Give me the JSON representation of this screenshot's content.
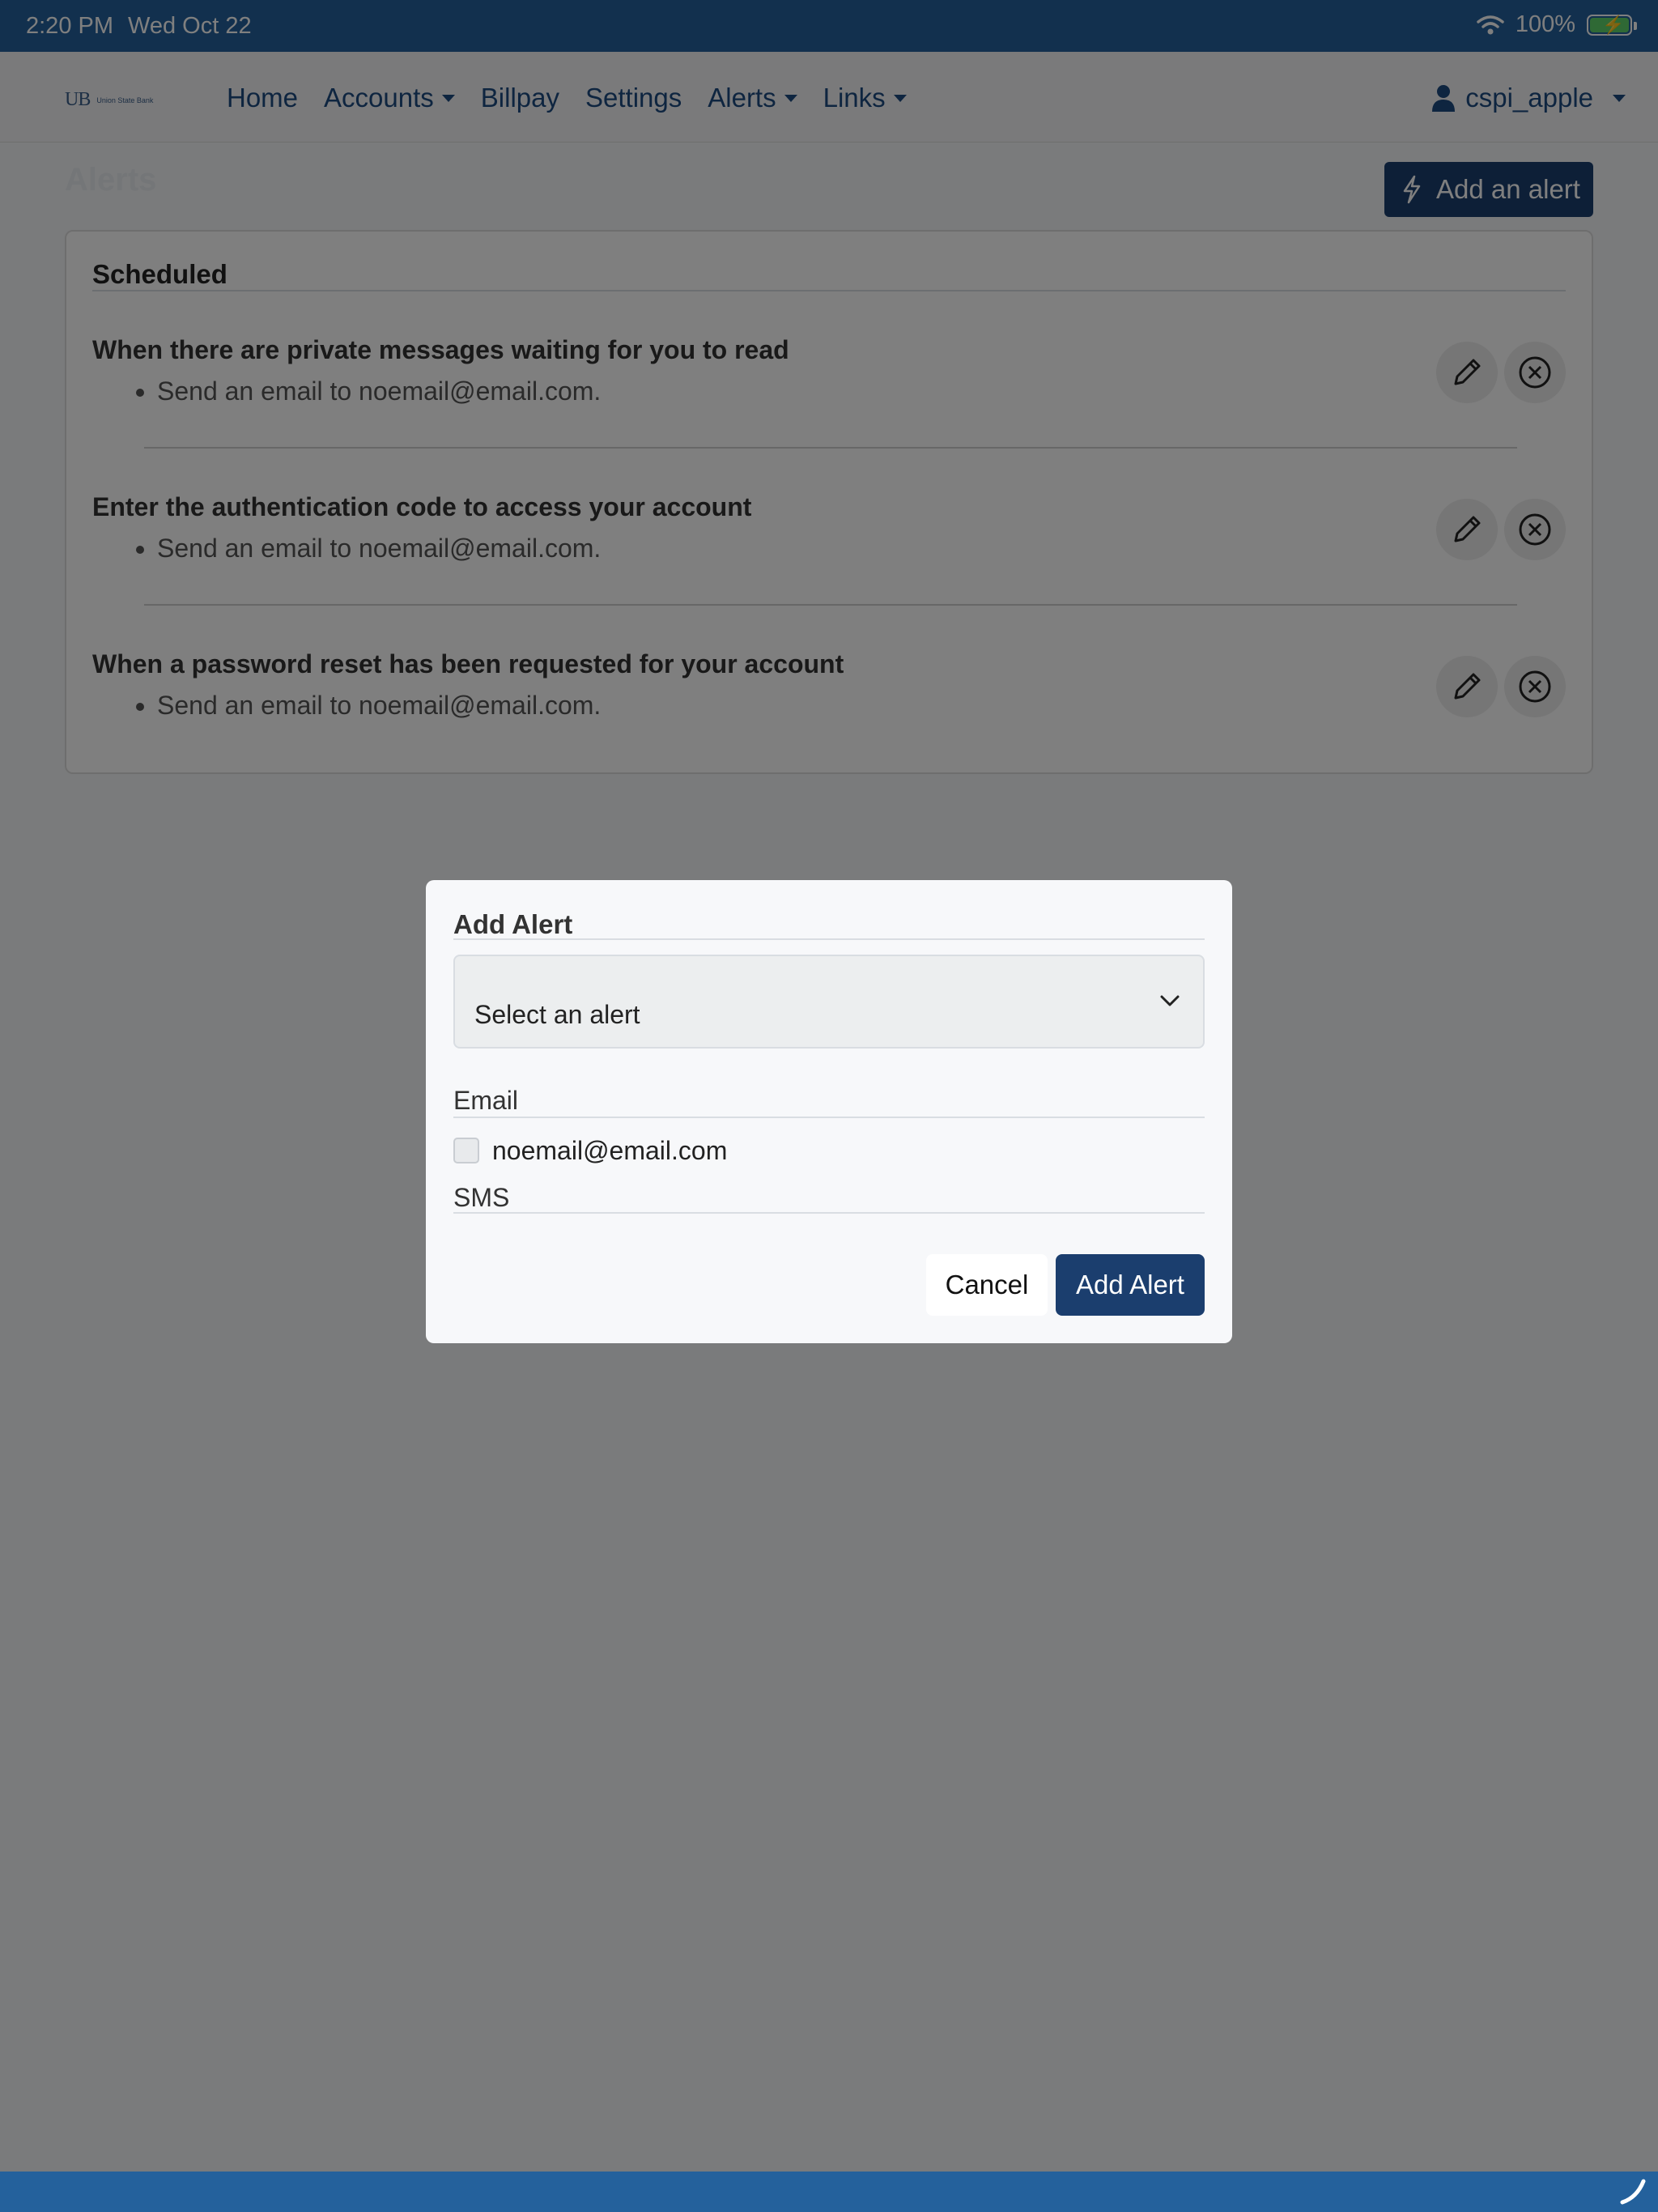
{
  "status_bar": {
    "time": "2:20 PM",
    "date": "Wed Oct 22",
    "battery": "100%",
    "icons": [
      "wifi-icon",
      "battery-charging-icon"
    ]
  },
  "navbar": {
    "logo_mark": "UB",
    "logo_name": "Union State Bank",
    "links": {
      "home": "Home",
      "accounts": "Accounts",
      "billpay": "Billpay",
      "settings": "Settings",
      "alerts": "Alerts",
      "links": "Links"
    },
    "user": "cspi_apple"
  },
  "page": {
    "title": "Alerts",
    "add_button": "Add an alert"
  },
  "scheduled": {
    "header": "Scheduled",
    "items": [
      {
        "title": "When there are private messages waiting for you to read",
        "detail": "Send an email to noemail@email.com."
      },
      {
        "title": "Enter the authentication code to access your account",
        "detail": "Send an email to noemail@email.com."
      },
      {
        "title": "When a password reset has been requested for your account",
        "detail": "Send an email to noemail@email.com."
      }
    ]
  },
  "modal": {
    "title": "Add Alert",
    "select_placeholder": "Select an alert",
    "email_label": "Email",
    "email_option": "noemail@email.com",
    "sms_label": "SMS",
    "cancel": "Cancel",
    "submit": "Add Alert"
  },
  "colors": {
    "status_bar": "#24619c",
    "primary": "#1b3e6e",
    "nav_link": "#1d4a80"
  }
}
